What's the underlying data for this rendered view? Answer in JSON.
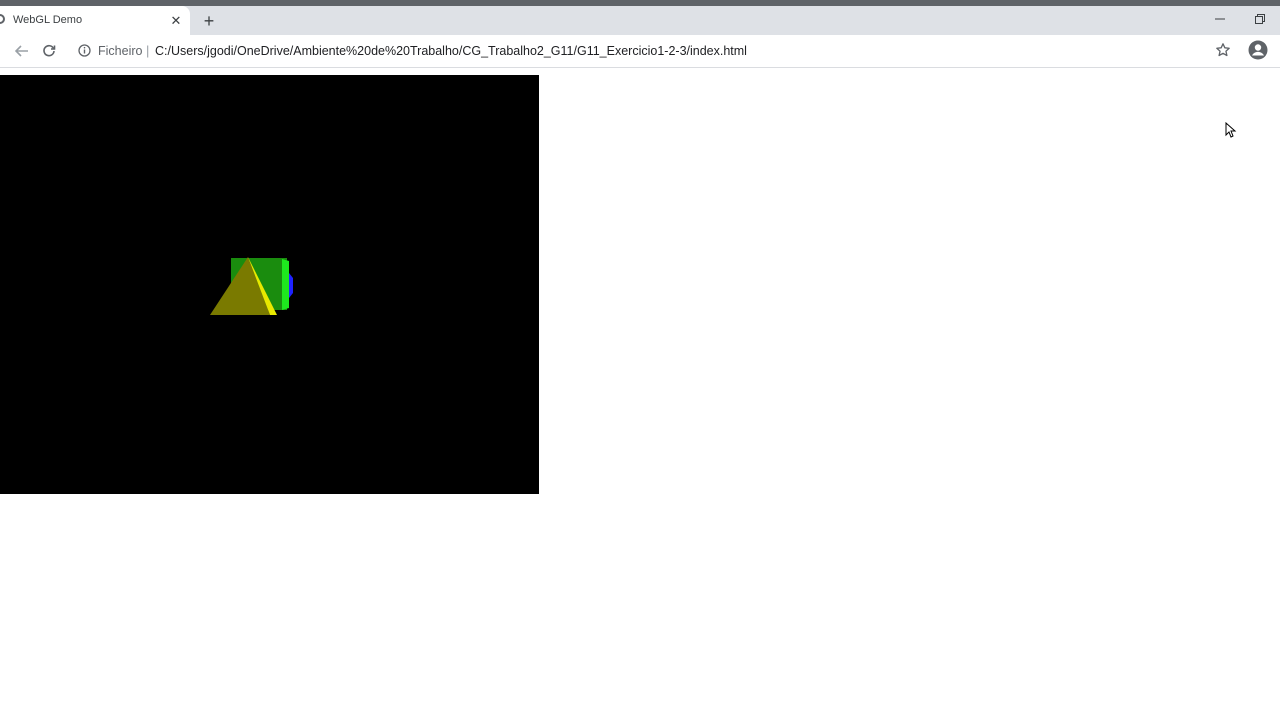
{
  "browser": {
    "tab": {
      "title": "WebGL Demo",
      "close_glyph": "✕",
      "favicon": "globe-icon"
    },
    "new_tab_glyph": "+",
    "window_controls": {
      "minimize": "minimize-icon",
      "restore": "restore-icon"
    },
    "toolbar": {
      "back": "arrow-left-icon",
      "forward": "arrow-right-icon",
      "reload": "reload-icon",
      "site_info": "info-icon",
      "scheme_label": "Ficheiro",
      "separator": "|",
      "url": "C:/Users/jgodi/OneDrive/Ambiente%20de%20Trabalho/CG_Trabalho2_G11/G11_Exercicio1-2-3/index.html",
      "bookmark": "star-icon",
      "profile": "profile-icon"
    }
  },
  "page": {
    "canvas": {
      "background": "#000000",
      "scene": {
        "cube_front_color": "#1a8c0e",
        "cube_side_color": "#1ee81e",
        "cube_edge_color": "#1e22ff",
        "pyramid_face_color": "#7a7a00",
        "pyramid_edge_color": "#ffff00"
      }
    }
  },
  "colors": {
    "titlebar": "#5f6368",
    "tabstrip": "#dee1e6",
    "active_tab": "#ffffff",
    "text_primary": "#202124",
    "text_secondary": "#5f6368"
  }
}
